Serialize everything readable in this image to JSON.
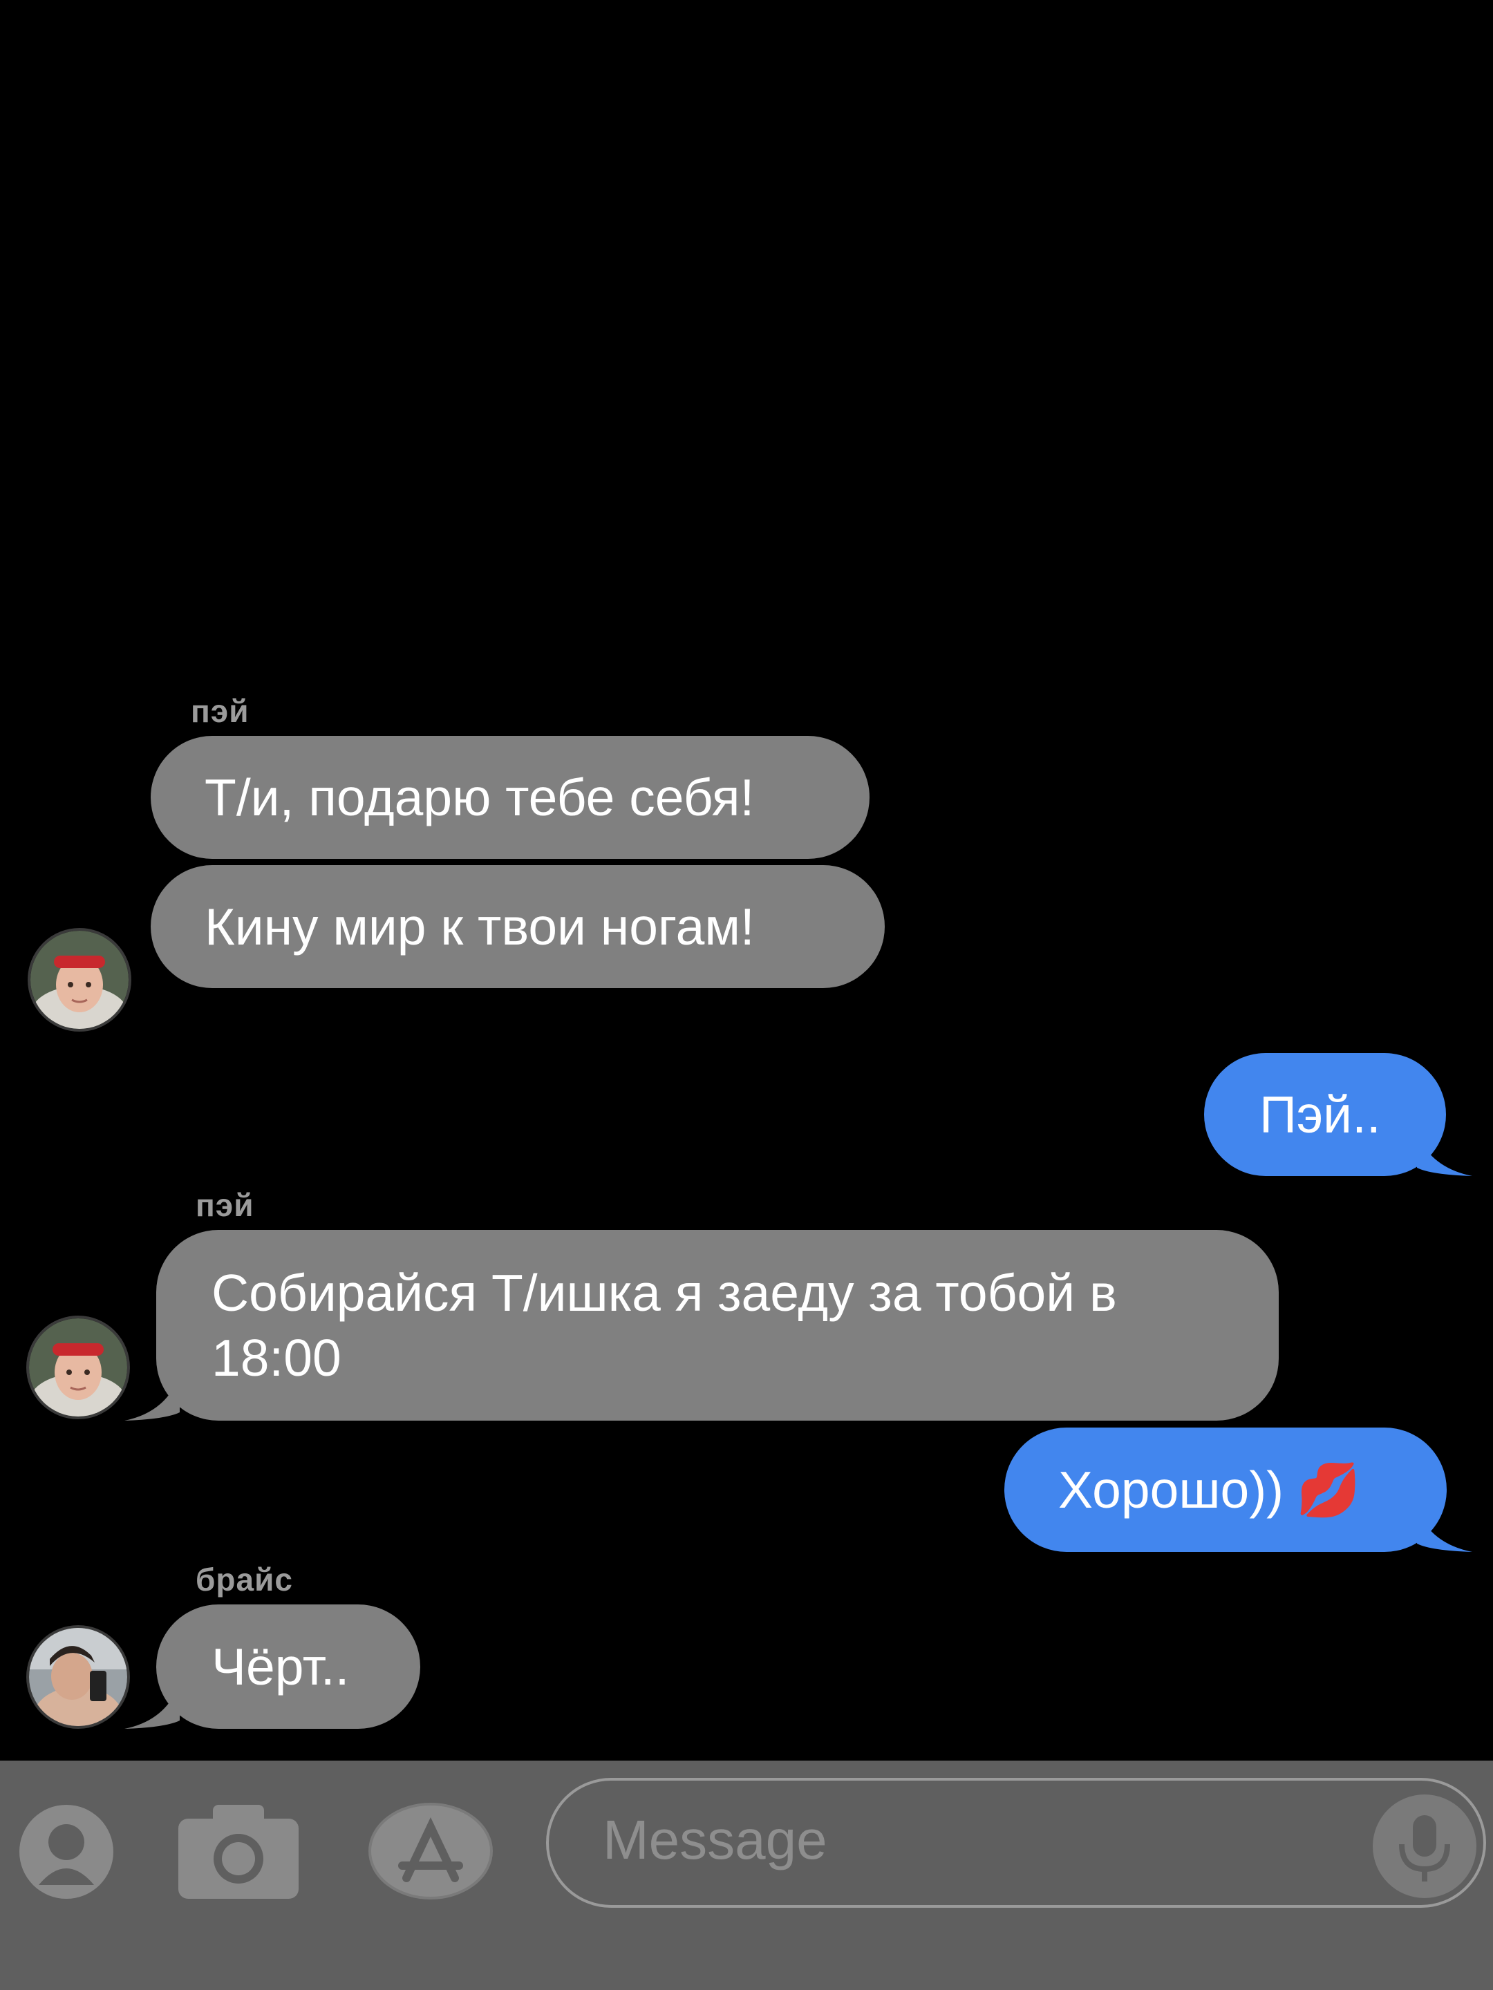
{
  "messages": [
    {
      "sender": "пэй",
      "text": "Т/и, подарю тебе себя!",
      "side": "incoming"
    },
    {
      "text": "Кину мир к твои ногам!",
      "side": "incoming"
    },
    {
      "text": "Пэй..",
      "side": "outgoing"
    },
    {
      "sender": "пэй",
      "text": "Собирайся Т/ишка я заеду за тобой в 18:00",
      "side": "incoming"
    },
    {
      "text": "Хорошо))",
      "emoji": "💋",
      "side": "outgoing"
    },
    {
      "sender": "брайс",
      "text": "Чёрт..",
      "side": "incoming"
    }
  ],
  "compose": {
    "placeholder": "Message",
    "icons": [
      "contact-icon",
      "camera-icon",
      "app-store-icon",
      "microphone-icon"
    ]
  },
  "colors": {
    "incoming_bubble": "#808080",
    "outgoing_bubble": "#4286ee",
    "background": "#000000",
    "compose_bar": "#5f5f5f"
  }
}
